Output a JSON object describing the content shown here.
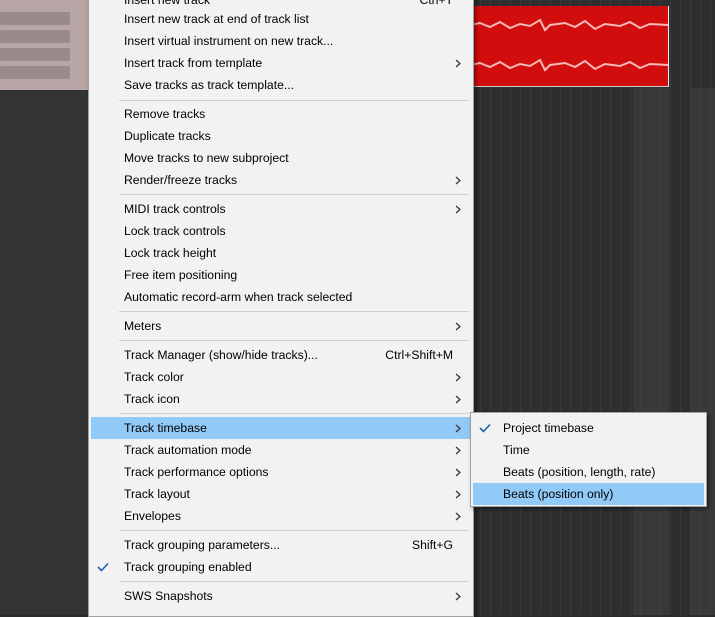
{
  "main_menu": {
    "items": [
      {
        "label": "Insert new track",
        "shortcut": "Ctrl+T"
      },
      {
        "label": "Insert new track at end of track list"
      },
      {
        "label": "Insert virtual instrument on new track..."
      },
      {
        "label": "Insert track from template"
      },
      {
        "label": "Save tracks as track template..."
      },
      {
        "label": "Remove tracks"
      },
      {
        "label": "Duplicate tracks"
      },
      {
        "label": "Move tracks to new subproject"
      },
      {
        "label": "Render/freeze tracks"
      },
      {
        "label": "MIDI track controls"
      },
      {
        "label": "Lock track controls"
      },
      {
        "label": "Lock track height"
      },
      {
        "label": "Free item positioning"
      },
      {
        "label": "Automatic record-arm when track selected"
      },
      {
        "label": "Meters"
      },
      {
        "label": "Track Manager (show/hide tracks)...",
        "shortcut": "Ctrl+Shift+M"
      },
      {
        "label": "Track color"
      },
      {
        "label": "Track icon"
      },
      {
        "label": "Track timebase"
      },
      {
        "label": "Track automation mode"
      },
      {
        "label": "Track performance options"
      },
      {
        "label": "Track layout"
      },
      {
        "label": "Envelopes"
      },
      {
        "label": "Track grouping parameters...",
        "shortcut": "Shift+G"
      },
      {
        "label": "Track grouping enabled"
      },
      {
        "label": "SWS Snapshots"
      }
    ]
  },
  "timebase_submenu": {
    "items": [
      {
        "label": "Project timebase"
      },
      {
        "label": "Time"
      },
      {
        "label": "Beats (position, length, rate)"
      },
      {
        "label": "Beats (position only)"
      }
    ]
  },
  "icons": {
    "check": "checkmark-icon",
    "submenu": "submenu-arrow-icon"
  },
  "colors": {
    "highlight": "#91c9f7",
    "menu_bg": "#f2f2f2",
    "media_item": "#d20d0d"
  }
}
